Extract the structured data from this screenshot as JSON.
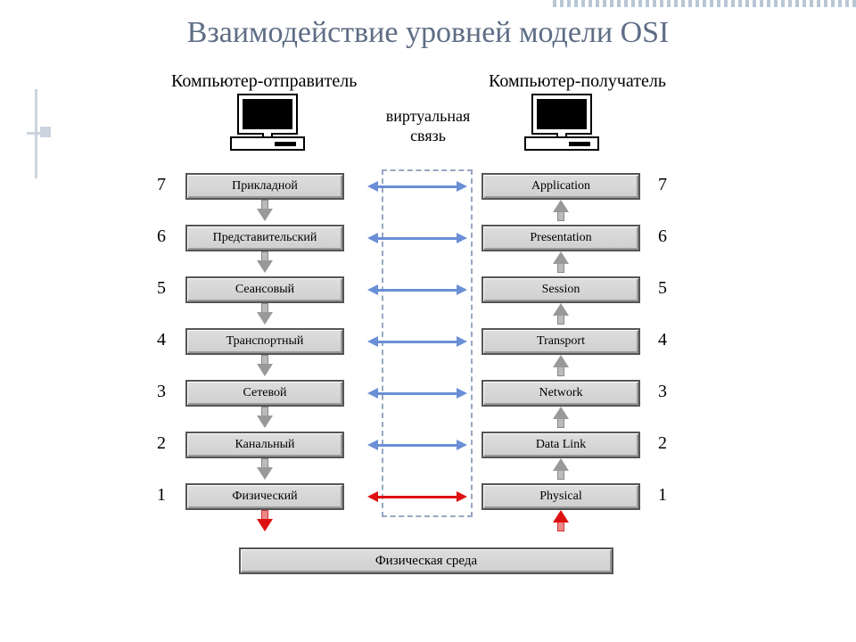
{
  "title": "Взаимодействие уровней модели OSI",
  "leftHeader": "Компьютер-отправитель",
  "rightHeader": "Компьютер-получатель",
  "virtualLink1": "виртуальная",
  "virtualLink2": "связь",
  "mediumLabel": "Физическая среда",
  "layers": {
    "left": [
      "Прикладной",
      "Представительский",
      "Сеансовый",
      "Транспортный",
      "Сетевой",
      "Канальный",
      "Физический"
    ],
    "right": [
      "Application",
      "Presentation",
      "Session",
      "Transport",
      "Network",
      "Data Link",
      "Physical"
    ],
    "numbers": [
      "7",
      "6",
      "5",
      "4",
      "3",
      "2",
      "1"
    ]
  }
}
